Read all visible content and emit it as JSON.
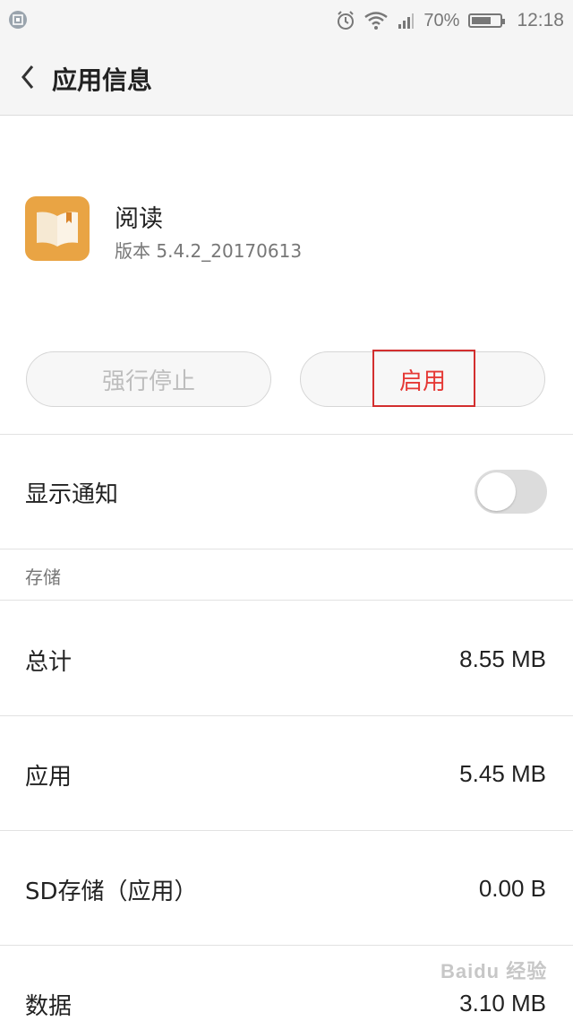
{
  "status_bar": {
    "battery_percent": "70%",
    "battery_level": 0.7,
    "time": "12:18",
    "icons": [
      "app-notification-icon",
      "alarm-icon",
      "wifi-icon",
      "signal-icon",
      "battery-icon"
    ]
  },
  "header": {
    "title": "应用信息",
    "back_icon": "chevron-left-icon"
  },
  "app": {
    "name": "阅读",
    "version": "版本 5.4.2_20170613",
    "icon": "book-icon",
    "icon_color": "#e9a444"
  },
  "buttons": {
    "force_stop": "强行停止",
    "enable": "启用",
    "enable_color": "#e53935",
    "highlight_color": "#d32f2f"
  },
  "notification": {
    "label": "显示通知",
    "enabled": false
  },
  "storage": {
    "section_title": "存储",
    "rows": [
      {
        "label": "总计",
        "value": "8.55 MB"
      },
      {
        "label": "应用",
        "value": "5.45 MB"
      },
      {
        "label": "SD存储（应用）",
        "value": "0.00 B"
      },
      {
        "label": "数据",
        "value": "3.10 MB"
      }
    ]
  },
  "watermark": "Baidu 经验"
}
